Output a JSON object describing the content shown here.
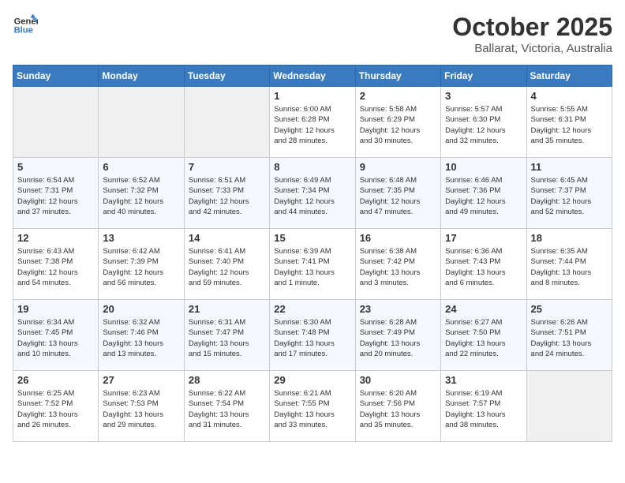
{
  "header": {
    "logo_line1": "General",
    "logo_line2": "Blue",
    "month_year": "October 2025",
    "location": "Ballarat, Victoria, Australia"
  },
  "weekdays": [
    "Sunday",
    "Monday",
    "Tuesday",
    "Wednesday",
    "Thursday",
    "Friday",
    "Saturday"
  ],
  "weeks": [
    [
      {
        "day": "",
        "info": ""
      },
      {
        "day": "",
        "info": ""
      },
      {
        "day": "",
        "info": ""
      },
      {
        "day": "1",
        "info": "Sunrise: 6:00 AM\nSunset: 6:28 PM\nDaylight: 12 hours\nand 28 minutes."
      },
      {
        "day": "2",
        "info": "Sunrise: 5:58 AM\nSunset: 6:29 PM\nDaylight: 12 hours\nand 30 minutes."
      },
      {
        "day": "3",
        "info": "Sunrise: 5:57 AM\nSunset: 6:30 PM\nDaylight: 12 hours\nand 32 minutes."
      },
      {
        "day": "4",
        "info": "Sunrise: 5:55 AM\nSunset: 6:31 PM\nDaylight: 12 hours\nand 35 minutes."
      }
    ],
    [
      {
        "day": "5",
        "info": "Sunrise: 6:54 AM\nSunset: 7:31 PM\nDaylight: 12 hours\nand 37 minutes."
      },
      {
        "day": "6",
        "info": "Sunrise: 6:52 AM\nSunset: 7:32 PM\nDaylight: 12 hours\nand 40 minutes."
      },
      {
        "day": "7",
        "info": "Sunrise: 6:51 AM\nSunset: 7:33 PM\nDaylight: 12 hours\nand 42 minutes."
      },
      {
        "day": "8",
        "info": "Sunrise: 6:49 AM\nSunset: 7:34 PM\nDaylight: 12 hours\nand 44 minutes."
      },
      {
        "day": "9",
        "info": "Sunrise: 6:48 AM\nSunset: 7:35 PM\nDaylight: 12 hours\nand 47 minutes."
      },
      {
        "day": "10",
        "info": "Sunrise: 6:46 AM\nSunset: 7:36 PM\nDaylight: 12 hours\nand 49 minutes."
      },
      {
        "day": "11",
        "info": "Sunrise: 6:45 AM\nSunset: 7:37 PM\nDaylight: 12 hours\nand 52 minutes."
      }
    ],
    [
      {
        "day": "12",
        "info": "Sunrise: 6:43 AM\nSunset: 7:38 PM\nDaylight: 12 hours\nand 54 minutes."
      },
      {
        "day": "13",
        "info": "Sunrise: 6:42 AM\nSunset: 7:39 PM\nDaylight: 12 hours\nand 56 minutes."
      },
      {
        "day": "14",
        "info": "Sunrise: 6:41 AM\nSunset: 7:40 PM\nDaylight: 12 hours\nand 59 minutes."
      },
      {
        "day": "15",
        "info": "Sunrise: 6:39 AM\nSunset: 7:41 PM\nDaylight: 13 hours\nand 1 minute."
      },
      {
        "day": "16",
        "info": "Sunrise: 6:38 AM\nSunset: 7:42 PM\nDaylight: 13 hours\nand 3 minutes."
      },
      {
        "day": "17",
        "info": "Sunrise: 6:36 AM\nSunset: 7:43 PM\nDaylight: 13 hours\nand 6 minutes."
      },
      {
        "day": "18",
        "info": "Sunrise: 6:35 AM\nSunset: 7:44 PM\nDaylight: 13 hours\nand 8 minutes."
      }
    ],
    [
      {
        "day": "19",
        "info": "Sunrise: 6:34 AM\nSunset: 7:45 PM\nDaylight: 13 hours\nand 10 minutes."
      },
      {
        "day": "20",
        "info": "Sunrise: 6:32 AM\nSunset: 7:46 PM\nDaylight: 13 hours\nand 13 minutes."
      },
      {
        "day": "21",
        "info": "Sunrise: 6:31 AM\nSunset: 7:47 PM\nDaylight: 13 hours\nand 15 minutes."
      },
      {
        "day": "22",
        "info": "Sunrise: 6:30 AM\nSunset: 7:48 PM\nDaylight: 13 hours\nand 17 minutes."
      },
      {
        "day": "23",
        "info": "Sunrise: 6:28 AM\nSunset: 7:49 PM\nDaylight: 13 hours\nand 20 minutes."
      },
      {
        "day": "24",
        "info": "Sunrise: 6:27 AM\nSunset: 7:50 PM\nDaylight: 13 hours\nand 22 minutes."
      },
      {
        "day": "25",
        "info": "Sunrise: 6:26 AM\nSunset: 7:51 PM\nDaylight: 13 hours\nand 24 minutes."
      }
    ],
    [
      {
        "day": "26",
        "info": "Sunrise: 6:25 AM\nSunset: 7:52 PM\nDaylight: 13 hours\nand 26 minutes."
      },
      {
        "day": "27",
        "info": "Sunrise: 6:23 AM\nSunset: 7:53 PM\nDaylight: 13 hours\nand 29 minutes."
      },
      {
        "day": "28",
        "info": "Sunrise: 6:22 AM\nSunset: 7:54 PM\nDaylight: 13 hours\nand 31 minutes."
      },
      {
        "day": "29",
        "info": "Sunrise: 6:21 AM\nSunset: 7:55 PM\nDaylight: 13 hours\nand 33 minutes."
      },
      {
        "day": "30",
        "info": "Sunrise: 6:20 AM\nSunset: 7:56 PM\nDaylight: 13 hours\nand 35 minutes."
      },
      {
        "day": "31",
        "info": "Sunrise: 6:19 AM\nSunset: 7:57 PM\nDaylight: 13 hours\nand 38 minutes."
      },
      {
        "day": "",
        "info": ""
      }
    ]
  ]
}
